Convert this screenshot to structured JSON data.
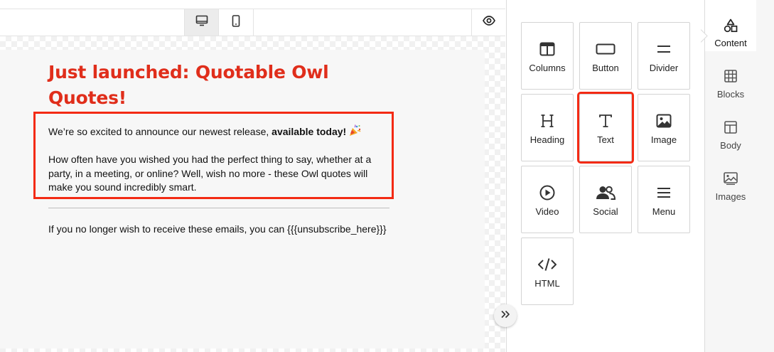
{
  "editor": {
    "view_modes": [
      {
        "name": "desktop",
        "icon": "desktop-icon",
        "active": true
      },
      {
        "name": "mobile",
        "icon": "mobile-icon",
        "active": false
      }
    ],
    "preview_icon": "eye-icon"
  },
  "email": {
    "headline": "Just launched: Quotable Owl Quotes!",
    "headline_color": "#e02e1b",
    "body": {
      "intro_text": "We’re so excited to announce our newest release, ",
      "intro_bold": "available today!",
      "intro_emoji": "party-popper-icon",
      "paragraph": "How often have you wished you had the perfect thing to say, whether at a party, in a meeting, or online? Well, wish no more - these Owl quotes will make you sound incredibly smart."
    },
    "footer": "If you no longer wish to receive these emails, you can {{{unsubscribe_here}}}"
  },
  "highlight_color": "#f32a14",
  "tools": [
    {
      "label": "Columns",
      "icon": "columns-icon"
    },
    {
      "label": "Button",
      "icon": "button-icon"
    },
    {
      "label": "Divider",
      "icon": "divider-icon"
    },
    {
      "label": "Heading",
      "icon": "heading-icon"
    },
    {
      "label": "Text",
      "icon": "text-icon",
      "selected": true
    },
    {
      "label": "Image",
      "icon": "image-icon"
    },
    {
      "label": "Video",
      "icon": "video-icon"
    },
    {
      "label": "Social",
      "icon": "social-icon"
    },
    {
      "label": "Menu",
      "icon": "menu-icon"
    },
    {
      "label": "HTML",
      "icon": "code-icon"
    }
  ],
  "nav": [
    {
      "label": "Content",
      "icon": "shapes-icon",
      "active": true
    },
    {
      "label": "Blocks",
      "icon": "blocks-icon"
    },
    {
      "label": "Body",
      "icon": "layout-icon"
    },
    {
      "label": "Images",
      "icon": "images-icon"
    }
  ]
}
